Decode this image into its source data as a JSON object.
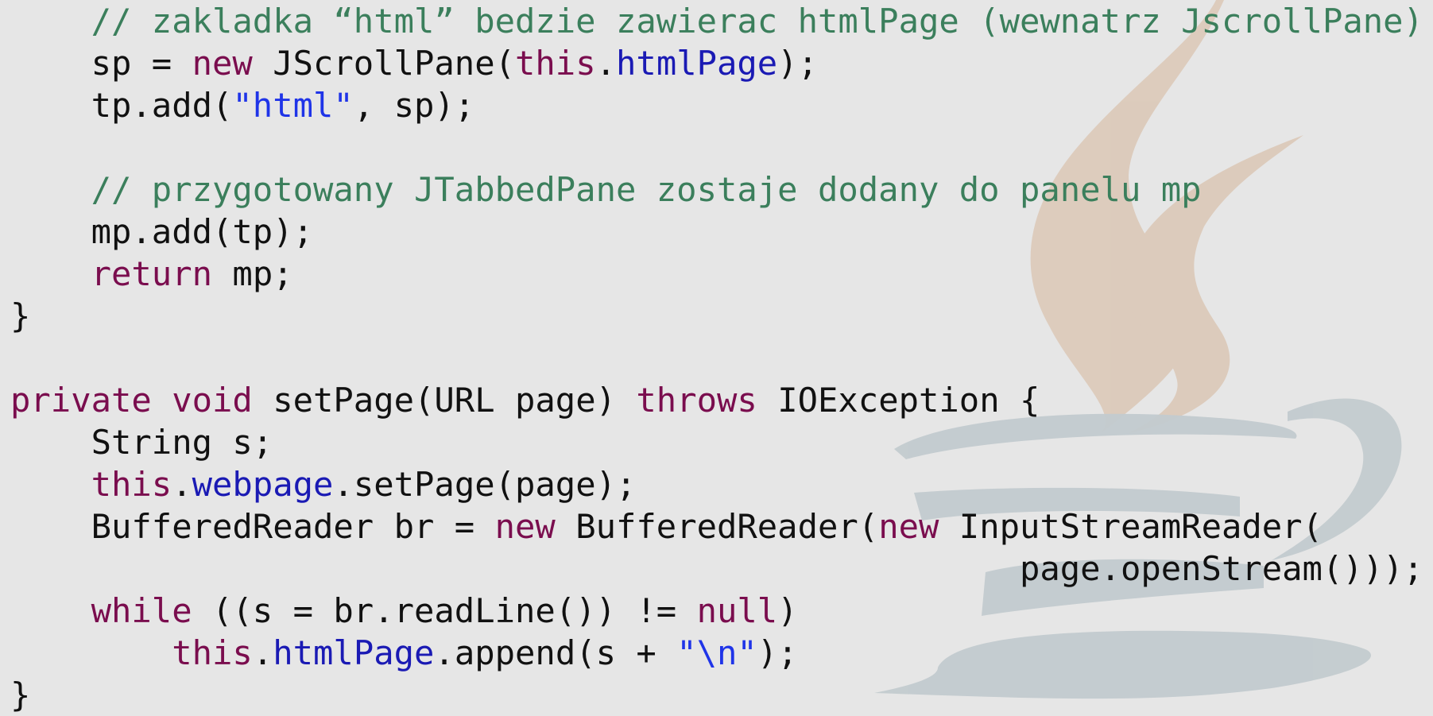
{
  "colors": {
    "background": "#e6e6e6",
    "plain": "#111111",
    "keyword": "#7a0d4e",
    "field": "#1a1ab4",
    "string": "#1f34e8",
    "comment": "#3b7f5c",
    "logo_steam": "#dcc9b8",
    "logo_cup": "#c3cbcf"
  },
  "watermark": {
    "icon": "java-coffee-cup-logo"
  },
  "code_lines": [
    {
      "indent": 4,
      "tokens": [
        {
          "t": "comment",
          "v": "// zakladka “html” bedzie zawierac htmlPage (wewnatrz JscrollPane)"
        }
      ]
    },
    {
      "indent": 4,
      "tokens": [
        {
          "t": "plain",
          "v": "sp = "
        },
        {
          "t": "keyword",
          "v": "new"
        },
        {
          "t": "plain",
          "v": " JScrollPane("
        },
        {
          "t": "keyword",
          "v": "this"
        },
        {
          "t": "plain",
          "v": "."
        },
        {
          "t": "field",
          "v": "htmlPage"
        },
        {
          "t": "plain",
          "v": ");"
        }
      ]
    },
    {
      "indent": 4,
      "tokens": [
        {
          "t": "plain",
          "v": "tp.add("
        },
        {
          "t": "string",
          "v": "\"html\""
        },
        {
          "t": "plain",
          "v": ", sp);"
        }
      ]
    },
    {
      "indent": 0,
      "tokens": []
    },
    {
      "indent": 4,
      "tokens": [
        {
          "t": "comment",
          "v": "// przygotowany JTabbedPane zostaje dodany do panelu mp"
        }
      ]
    },
    {
      "indent": 4,
      "tokens": [
        {
          "t": "plain",
          "v": "mp.add(tp);"
        }
      ]
    },
    {
      "indent": 4,
      "tokens": [
        {
          "t": "keyword",
          "v": "return"
        },
        {
          "t": "plain",
          "v": " mp;"
        }
      ]
    },
    {
      "indent": 0,
      "tokens": [
        {
          "t": "plain",
          "v": "}"
        }
      ]
    },
    {
      "indent": 0,
      "tokens": []
    },
    {
      "indent": 0,
      "tokens": [
        {
          "t": "keyword",
          "v": "private"
        },
        {
          "t": "plain",
          "v": " "
        },
        {
          "t": "keyword",
          "v": "void"
        },
        {
          "t": "plain",
          "v": " setPage(URL page) "
        },
        {
          "t": "keyword",
          "v": "throws"
        },
        {
          "t": "plain",
          "v": " IOException {"
        }
      ]
    },
    {
      "indent": 4,
      "tokens": [
        {
          "t": "plain",
          "v": "String s;"
        }
      ]
    },
    {
      "indent": 4,
      "tokens": [
        {
          "t": "keyword",
          "v": "this"
        },
        {
          "t": "plain",
          "v": "."
        },
        {
          "t": "field",
          "v": "webpage"
        },
        {
          "t": "plain",
          "v": ".setPage(page);"
        }
      ]
    },
    {
      "indent": 4,
      "tokens": [
        {
          "t": "plain",
          "v": "BufferedReader br = "
        },
        {
          "t": "keyword",
          "v": "new"
        },
        {
          "t": "plain",
          "v": " BufferedReader("
        },
        {
          "t": "keyword",
          "v": "new"
        },
        {
          "t": "plain",
          "v": " InputStreamReader("
        }
      ]
    },
    {
      "indent": 50,
      "tokens": [
        {
          "t": "plain",
          "v": "page.openStream()));"
        }
      ]
    },
    {
      "indent": 4,
      "tokens": [
        {
          "t": "keyword",
          "v": "while"
        },
        {
          "t": "plain",
          "v": " ((s = br.readLine()) != "
        },
        {
          "t": "keyword",
          "v": "null"
        },
        {
          "t": "plain",
          "v": ")"
        }
      ]
    },
    {
      "indent": 8,
      "tokens": [
        {
          "t": "keyword",
          "v": "this"
        },
        {
          "t": "plain",
          "v": "."
        },
        {
          "t": "field",
          "v": "htmlPage"
        },
        {
          "t": "plain",
          "v": ".append(s + "
        },
        {
          "t": "string",
          "v": "\"\\n\""
        },
        {
          "t": "plain",
          "v": ");"
        }
      ]
    },
    {
      "indent": 0,
      "tokens": [
        {
          "t": "plain",
          "v": "}"
        }
      ]
    }
  ]
}
